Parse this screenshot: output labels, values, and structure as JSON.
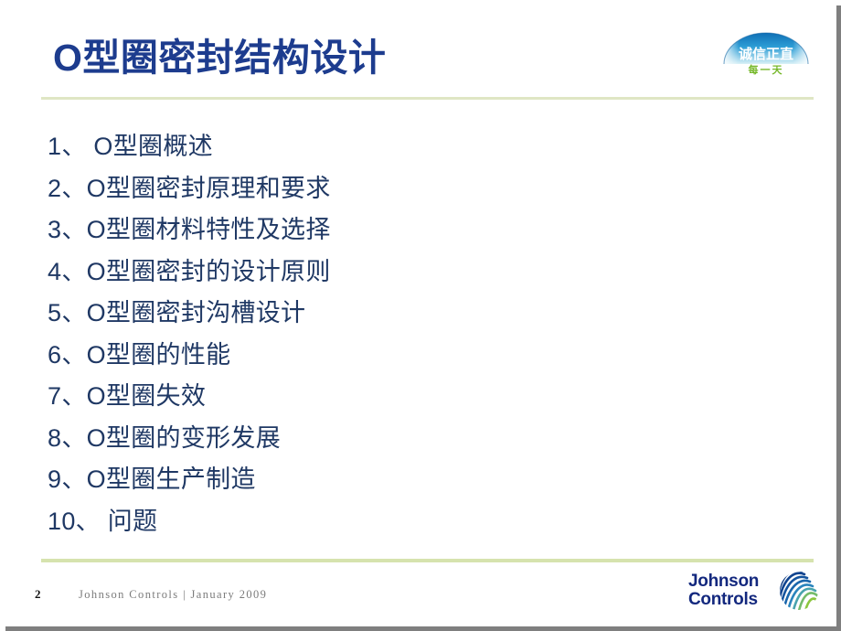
{
  "slide": {
    "title": "O型圈密封结构设计",
    "agenda": [
      {
        "label": "1、 O型圈概述"
      },
      {
        "label": "2、O型圈密封原理和要求"
      },
      {
        "label": "3、O型圈材料特性及选择"
      },
      {
        "label": "4、O型圈密封的设计原则"
      },
      {
        "label": "5、O型圈密封沟槽设计"
      },
      {
        "label": "6、O型圈的性能"
      },
      {
        "label": "7、O型圈失效"
      },
      {
        "label": "8、O型圈的变形发展"
      },
      {
        "label": "9、O型圈生产制造"
      },
      {
        "label": "10、 问题"
      }
    ]
  },
  "integrity_logo": {
    "name": "integrity-dome-logo",
    "primary_text": "诚信正直",
    "secondary_text": "每一天",
    "dome_color": "#1b7fc4",
    "primary_text_color": "#ffffff",
    "secondary_text_color": "#76b82a"
  },
  "footer": {
    "page_number": "2",
    "text": "Johnson Controls | January 2009"
  },
  "brand_logo": {
    "name": "johnson-controls-logo",
    "line1": "Johnson",
    "line2": "Controls",
    "text_color": "#13287e",
    "mark_blue": "#144d96",
    "mark_green": "#79b843"
  },
  "theme": {
    "title_color": "#1d3c8e",
    "body_color": "#1f3864",
    "rule_color": "#d6e3ae",
    "background": "#ffffff",
    "shadow_color": "#7f7f7f"
  }
}
